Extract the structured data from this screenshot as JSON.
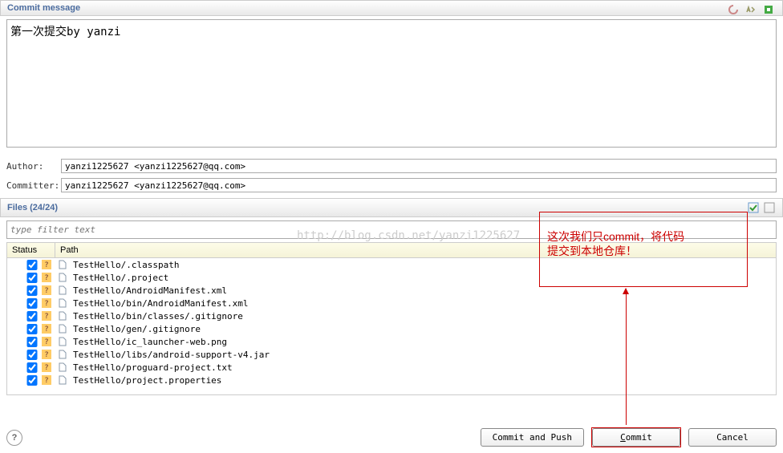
{
  "commit_message": {
    "header_label": "Commit message",
    "text": "第一次提交by yanzi"
  },
  "author": {
    "label": "Author:",
    "value": "yanzi1225627 <yanzi1225627@qq.com>"
  },
  "committer": {
    "label": "Committer:",
    "value": "yanzi1225627 <yanzi1225627@qq.com>"
  },
  "files": {
    "header_label": "Files (24/24)",
    "filter_placeholder": "type filter text",
    "columns": {
      "status": "Status",
      "path": "Path"
    },
    "rows": [
      {
        "checked": true,
        "path": "TestHello/.classpath"
      },
      {
        "checked": true,
        "path": "TestHello/.project"
      },
      {
        "checked": true,
        "path": "TestHello/AndroidManifest.xml"
      },
      {
        "checked": true,
        "path": "TestHello/bin/AndroidManifest.xml"
      },
      {
        "checked": true,
        "path": "TestHello/bin/classes/.gitignore"
      },
      {
        "checked": true,
        "path": "TestHello/gen/.gitignore"
      },
      {
        "checked": true,
        "path": "TestHello/ic_launcher-web.png"
      },
      {
        "checked": true,
        "path": "TestHello/libs/android-support-v4.jar"
      },
      {
        "checked": true,
        "path": "TestHello/proguard-project.txt"
      },
      {
        "checked": true,
        "path": "TestHello/project.properties"
      }
    ]
  },
  "buttons": {
    "commit_and_push": "Commit and Push",
    "commit": "Commit",
    "cancel": "Cancel"
  },
  "watermark": "http://blog.csdn.net/yanzi1225627",
  "annotation": "这次我们只commit，将代码\n提交到本地仓库！"
}
